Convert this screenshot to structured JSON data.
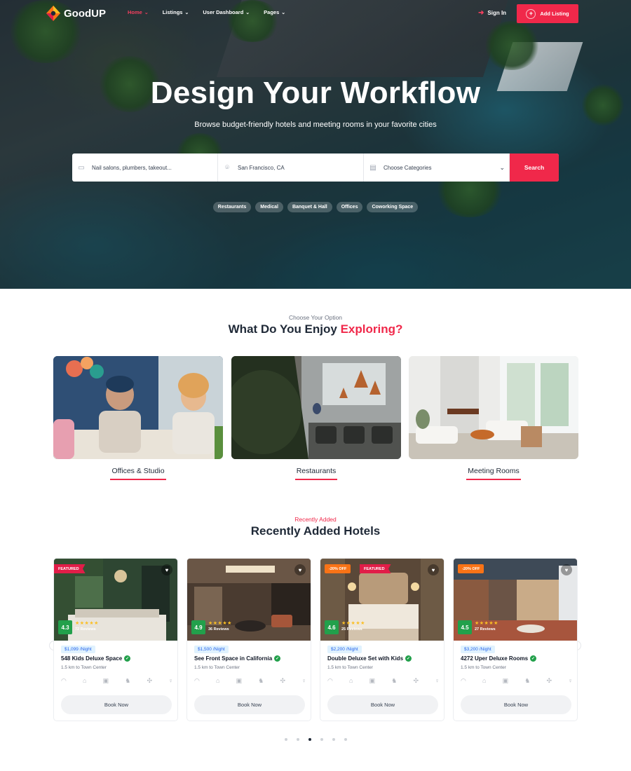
{
  "brand": {
    "name": "GoodUP",
    "accent": "#f0284a"
  },
  "nav": {
    "items": [
      {
        "label": "Home",
        "active": true
      },
      {
        "label": "Listings",
        "active": false
      },
      {
        "label": "User Dashboard",
        "active": false
      },
      {
        "label": "Pages",
        "active": false
      }
    ],
    "signin_label": "Sign In",
    "add_listing_label": "Add Listing"
  },
  "hero": {
    "title": "Design Your Workflow",
    "subtitle": "Browse budget-friendly hotels and meeting rooms in your favorite cities",
    "search": {
      "keyword_placeholder": "Nail salons, plumbers, takeout...",
      "location_placeholder": "San Francisco, CA",
      "category_placeholder": "Choose Categories",
      "button_label": "Search"
    },
    "chips": [
      "Restaurants",
      "Medical",
      "Banquet & Hall",
      "Offices",
      "Coworking Space"
    ]
  },
  "explore": {
    "eyebrow": "Choose Your Option",
    "title_main": "What Do You Enjoy ",
    "title_accent": "Exploring?",
    "categories": [
      {
        "label": "Offices & Studio"
      },
      {
        "label": "Restaurants"
      },
      {
        "label": "Meeting Rooms"
      }
    ]
  },
  "hotels": {
    "eyebrow": "Recently Added",
    "title": "Recently Added Hotels",
    "book_label": "Book Now",
    "items": [
      {
        "featured": "FEATURED",
        "discount": "",
        "rating": "4.3",
        "reviews": "72 Reviews",
        "price": "$1,099",
        "price_unit": "/Night",
        "name": "548 Kids Deluxe Space",
        "distance": "1.5 km to Town Center"
      },
      {
        "featured": "",
        "discount": "",
        "rating": "4.9",
        "reviews": "36 Reviews",
        "price": "$1,500",
        "price_unit": "/Night",
        "name": "See Front Space in California",
        "distance": "1.5 km to Town Center"
      },
      {
        "featured": "FEATURED",
        "discount": "-20% OFF",
        "rating": "4.6",
        "reviews": "25 Reviews",
        "price": "$2,200",
        "price_unit": "/Night",
        "name": "Double Deluxe Set with Kids",
        "distance": "1.5 km to Town Center"
      },
      {
        "featured": "",
        "discount": "-20% OFF",
        "rating": "4.5",
        "reviews": "27 Reviews",
        "price": "$3,200",
        "price_unit": "/Night",
        "name": "4272 Uper Deluxe Rooms",
        "distance": "1.5 km to Town Center"
      }
    ],
    "stars": "★★★★★",
    "amenity_icons": [
      "wifi-icon",
      "bath-icon",
      "tv-icon",
      "pet-icon",
      "ac-icon",
      "award-icon"
    ],
    "carousel": {
      "page_count": 6,
      "active_index": 2
    }
  }
}
